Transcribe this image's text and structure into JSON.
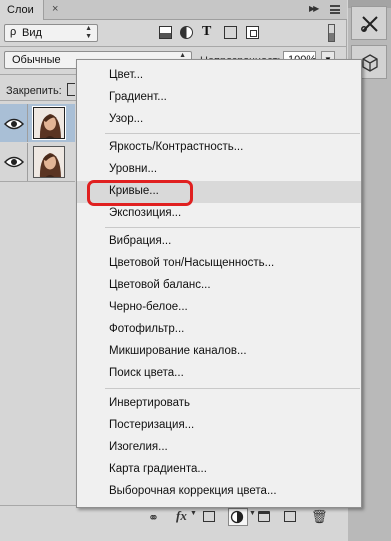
{
  "layers_panel": {
    "tab_title": "Слои",
    "filter": {
      "selected": "Вид"
    },
    "blend_mode": {
      "selected": "Обычные"
    },
    "opacity": {
      "label": "Непрозрачность:",
      "value": "100%"
    },
    "lock": {
      "label": "Закрепить:"
    },
    "layers": [
      {
        "visible": true,
        "selected": true
      },
      {
        "visible": true,
        "selected": false
      }
    ]
  },
  "adjustment_menu": {
    "groups": [
      [
        "Цвет...",
        "Градиент...",
        "Узор..."
      ],
      [
        "Яркость/Контрастность...",
        "Уровни...",
        "Кривые...",
        "Экспозиция..."
      ],
      [
        "Вибрация...",
        "Цветовой тон/Насыщенность...",
        "Цветовой баланс...",
        "Черно-белое...",
        "Фотофильтр...",
        "Микширование каналов...",
        "Поиск цвета..."
      ],
      [
        "Инвертировать",
        "Постеризация...",
        "Изогелия...",
        "Карта градиента...",
        "Выборочная коррекция цвета..."
      ]
    ],
    "hovered_item": "Кривые...",
    "highlight_color": "#e02020"
  },
  "bottom_toolbar": {
    "icons": [
      "link-icon",
      "fx-icon",
      "mask-icon",
      "adjustment-icon",
      "folder-icon",
      "new-layer-icon",
      "trash-icon"
    ],
    "fx_label": "fx"
  },
  "dock": {
    "icons": [
      "tools-icon",
      "3d-cube-icon"
    ]
  }
}
